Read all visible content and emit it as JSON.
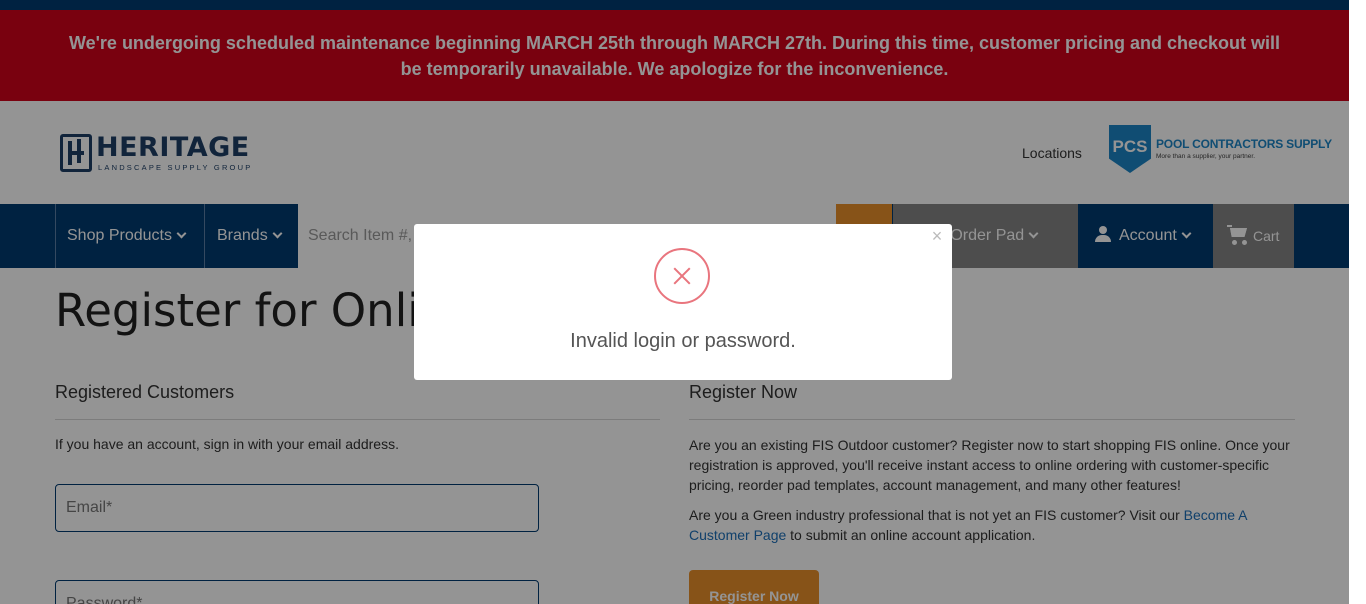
{
  "maintenance_banner": {
    "line1": "We're undergoing scheduled maintenance beginning MARCH 25th through MARCH 27th. During this time, customer pricing and checkout will",
    "line2": "be temporarily unavailable. We apologize for the inconvenience."
  },
  "header": {
    "logo_word": "HERITAGE",
    "logo_sub": "LANDSCAPE SUPPLY GROUP",
    "locations_label": "Locations",
    "pcs_badge": "PCS",
    "pcs_name": "POOL CONTRACTORS SUPPLY",
    "pcs_tagline": "More than a supplier, your partner."
  },
  "nav": {
    "shop_products": "Shop Products",
    "brands": "Brands",
    "search_placeholder": "Search Item #, Keyword...",
    "quick_order": "Quick Order Pad",
    "account": "Account",
    "cart": "Cart"
  },
  "main": {
    "title": "Register for Online Ordering",
    "left": {
      "heading": "Registered Customers",
      "intro": "If you have an account, sign in with your email address.",
      "email_placeholder": "Email*",
      "password_placeholder": "Password*"
    },
    "right": {
      "heading": "Register Now",
      "para1": "Are you an existing FIS Outdoor customer? Register now to start shopping FIS online. Once your registration is approved, you'll receive instant access to online ordering with customer-specific pricing, reorder pad templates, account management, and many other features!",
      "para2_before": "Are you a Green industry professional that is not yet an FIS customer? Visit our ",
      "para2_link": "Become A Customer Page",
      "para2_after": " to submit an online account application.",
      "button": "Register Now"
    }
  },
  "modal": {
    "close": "×",
    "message": "Invalid login or password."
  },
  "colors": {
    "brand_navy": "#003b71",
    "alert_red": "#d0021b",
    "accent_orange": "#e8902a",
    "error_pink": "#e9757e"
  }
}
